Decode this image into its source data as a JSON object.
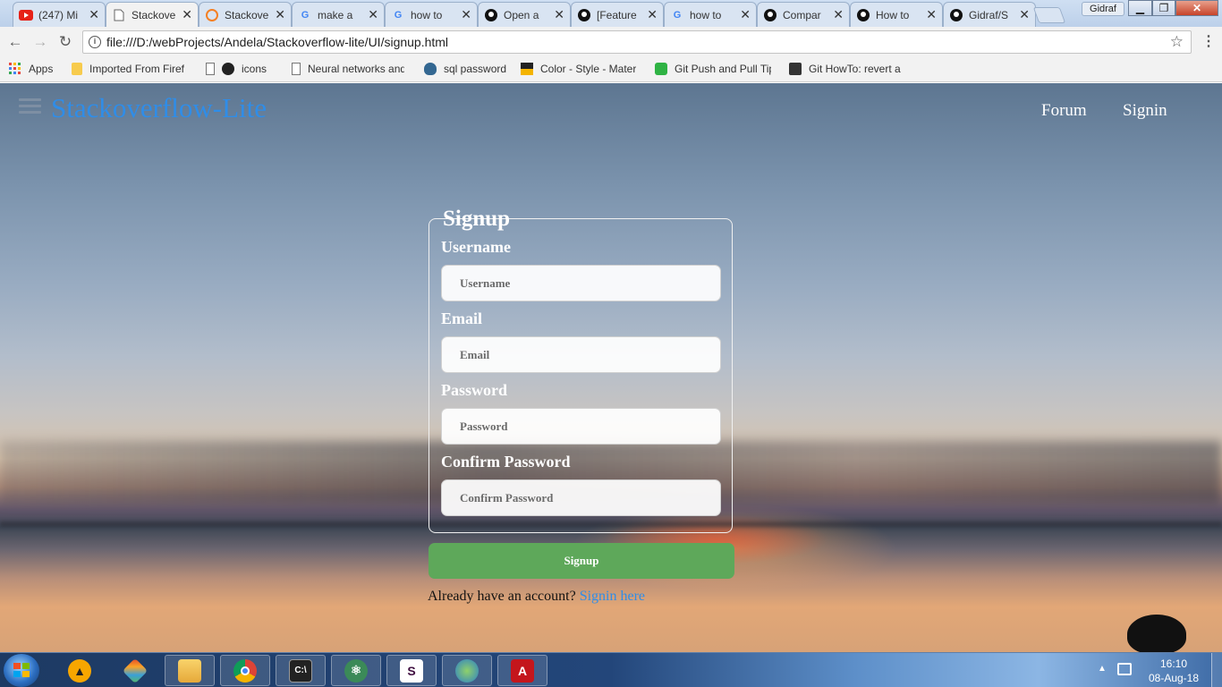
{
  "browser": {
    "tabs": [
      {
        "label": "(247) Mi",
        "icon": "youtube-icon",
        "color": "#e62117"
      },
      {
        "label": "Stackove",
        "icon": "page-icon",
        "color": "#666666",
        "active": true
      },
      {
        "label": "Stackove",
        "icon": "stackoverflow-icon",
        "color": "#f48024"
      },
      {
        "label": "make a",
        "icon": "google-icon",
        "color": "#4285f4"
      },
      {
        "label": "how to",
        "icon": "google-icon",
        "color": "#4285f4"
      },
      {
        "label": "Open a",
        "icon": "github-icon",
        "color": "#111111"
      },
      {
        "label": "[Feature",
        "icon": "github-icon",
        "color": "#111111"
      },
      {
        "label": "how to",
        "icon": "google-icon",
        "color": "#4285f4"
      },
      {
        "label": "Compar",
        "icon": "github-icon",
        "color": "#111111"
      },
      {
        "label": "How to",
        "icon": "github-icon",
        "color": "#111111"
      },
      {
        "label": "Gidraf/S",
        "icon": "github-icon",
        "color": "#111111"
      }
    ],
    "user": "Gidraf",
    "url": "file:///D:/webProjects/Andela/Stackoverflow-lite/UI/signup.html",
    "bookmarks": [
      {
        "label": "Apps",
        "icon": "apps-grid-icon"
      },
      {
        "label": "Imported From Firef",
        "icon": "folder-icon"
      },
      {
        "label": "icons",
        "icon": "page-icon"
      },
      {
        "label": "Neural networks and",
        "icon": "page-icon"
      },
      {
        "label": "sql password",
        "icon": "postgres-icon"
      },
      {
        "label": "Color - Style - Mater",
        "icon": "material-icon"
      },
      {
        "label": "Git Push and Pull Tip",
        "icon": "clock-icon"
      },
      {
        "label": "Git HowTo: revert a",
        "icon": "avatar-icon"
      }
    ]
  },
  "page": {
    "brand": "Stackoverflow-Lite",
    "nav": {
      "forum": "Forum",
      "signin": "Signin"
    },
    "form": {
      "legend": "Signup",
      "fields": [
        {
          "label": "Username",
          "placeholder": "Username",
          "value": ""
        },
        {
          "label": "Email",
          "placeholder": "Email",
          "value": ""
        },
        {
          "label": "Password",
          "placeholder": "Password",
          "value": ""
        },
        {
          "label": "Confirm Password",
          "placeholder": "Confirm Password",
          "value": ""
        }
      ],
      "submit": "Signup",
      "footer_text": "Already have an account?",
      "footer_link": "Signin here"
    },
    "colors": {
      "brand": "#2f8de8",
      "button": "#5ea85a"
    }
  },
  "taskbar": {
    "apps": [
      "avast-icon",
      "git-icon",
      "file-explorer-icon",
      "chrome-icon",
      "terminal-icon",
      "atom-icon",
      "slack-icon",
      "network-globe-icon",
      "acrobat-icon"
    ],
    "time": "16:10",
    "date": "08-Aug-18"
  }
}
